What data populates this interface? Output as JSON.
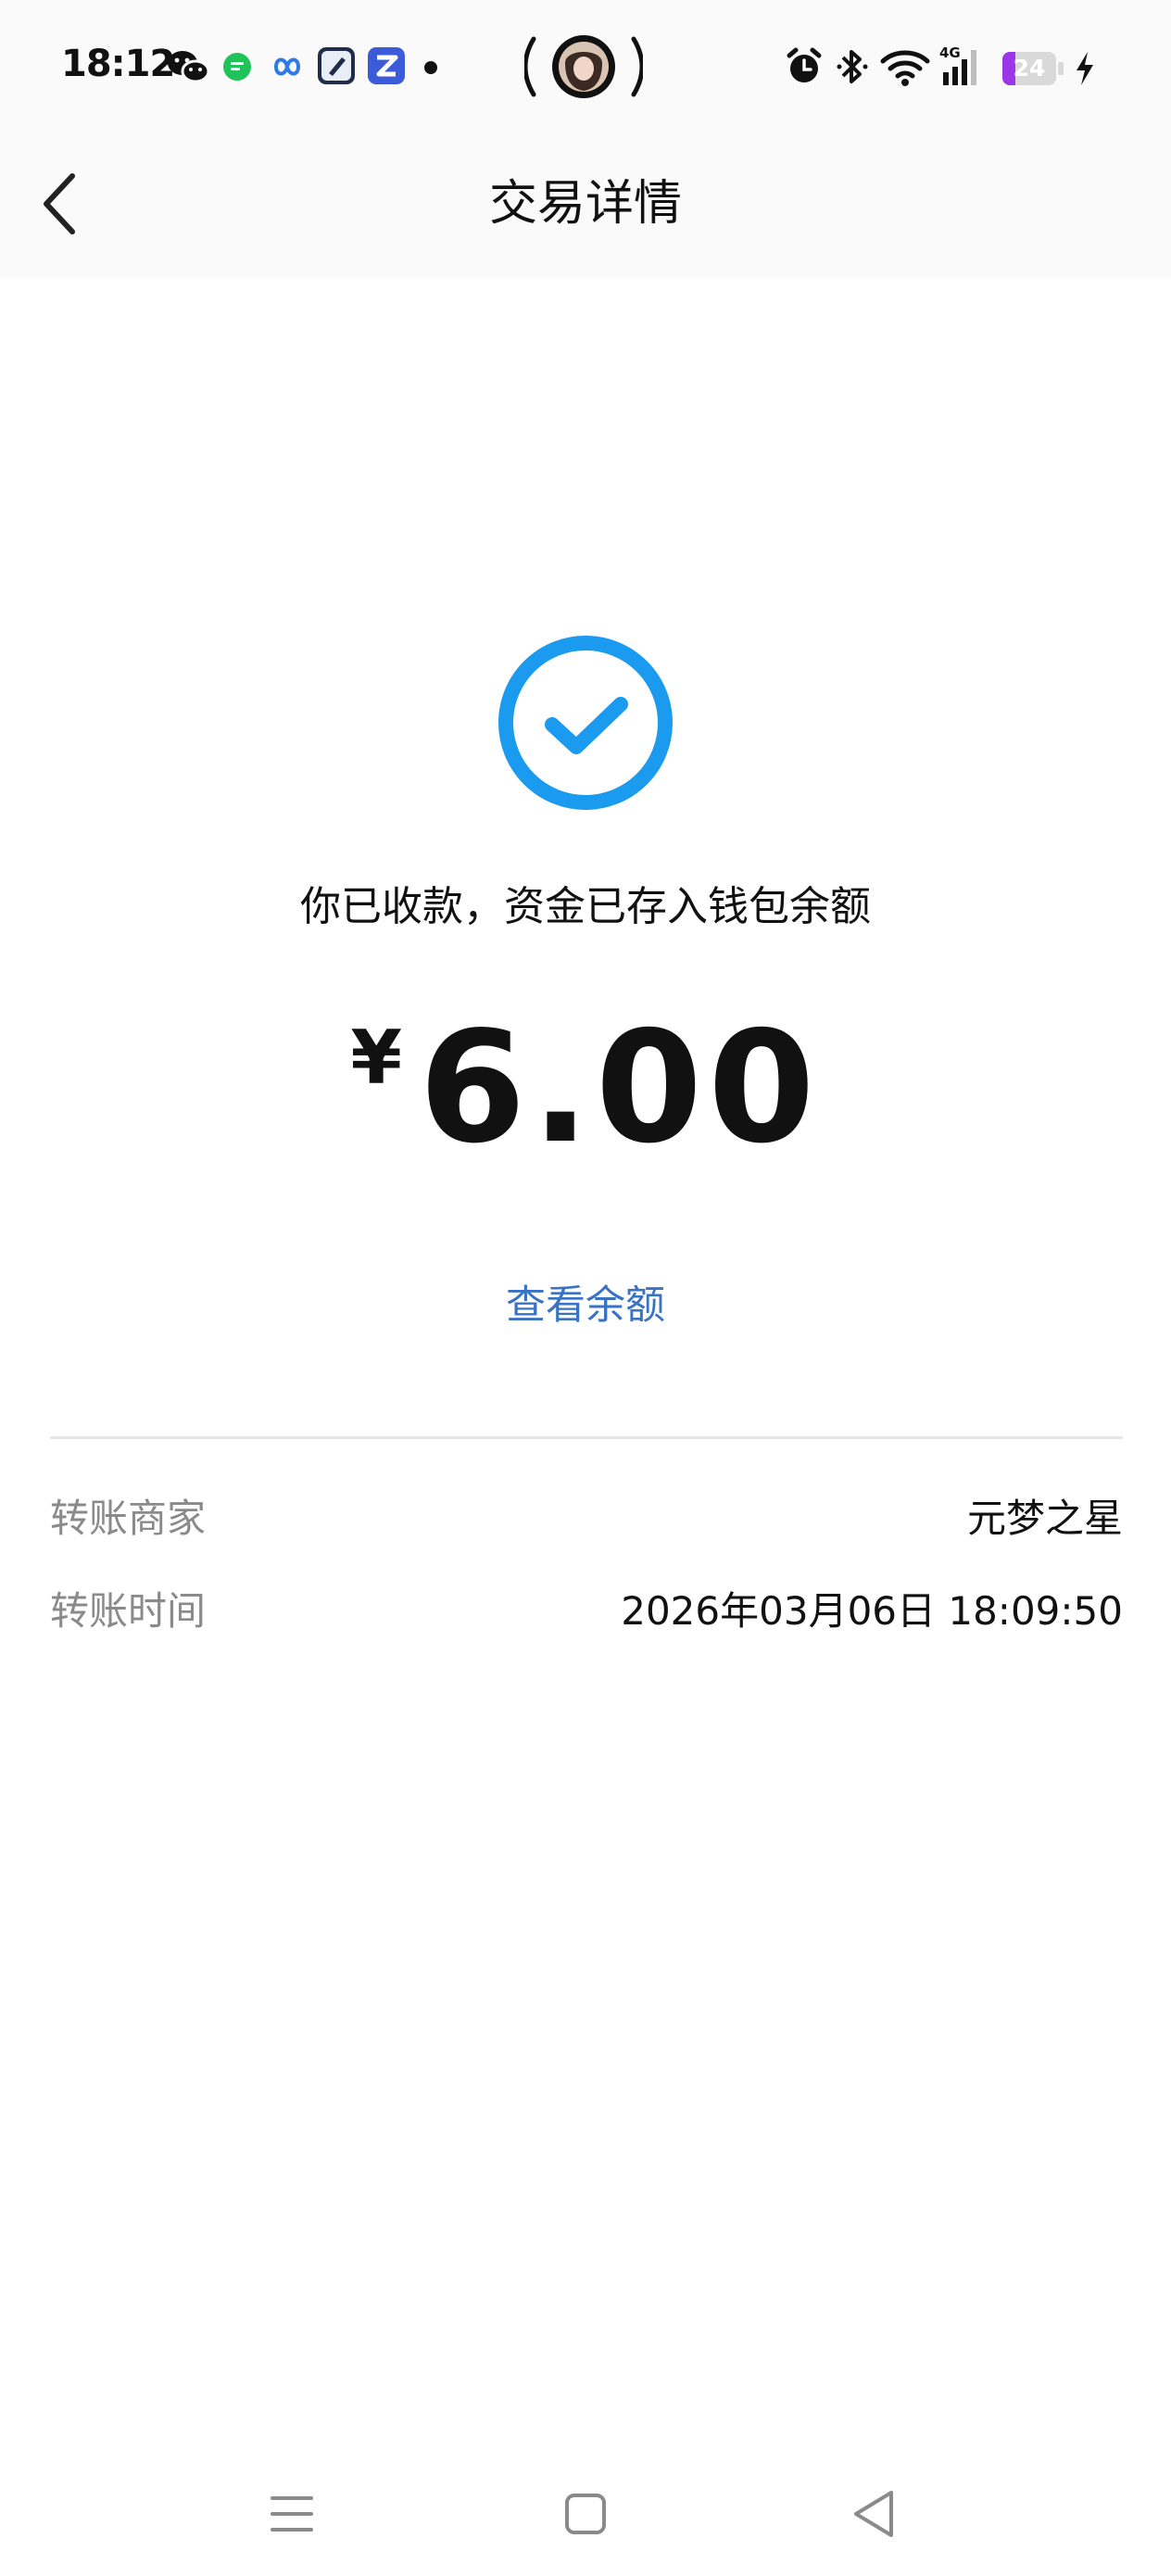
{
  "status_bar": {
    "time": "18:12",
    "battery_level": 24,
    "battery_text": "24",
    "network": "4G",
    "icons": [
      "wechat-icon",
      "message-app-icon",
      "cloud-app-icon",
      "edit-app-icon",
      "zhihu-app-icon",
      "notification-dot",
      "alarm-icon",
      "bluetooth-icon",
      "wifi-icon",
      "signal-icon",
      "battery-icon",
      "charging-icon"
    ]
  },
  "header": {
    "title": "交易详情"
  },
  "main": {
    "message": "你已收款，资金已存入钱包余额",
    "currency": "¥",
    "amount": "6.00",
    "view_balance_label": "查看余额",
    "details": [
      {
        "label": "转账商家",
        "value": "元梦之星"
      },
      {
        "label": "转账时间",
        "value": "2026年03月06日 18:09:50"
      }
    ]
  },
  "colors": {
    "accent": "#1a9bf0",
    "link": "#3a72c4",
    "label_gray": "#8a8a8a",
    "battery": "#9b35e8"
  }
}
